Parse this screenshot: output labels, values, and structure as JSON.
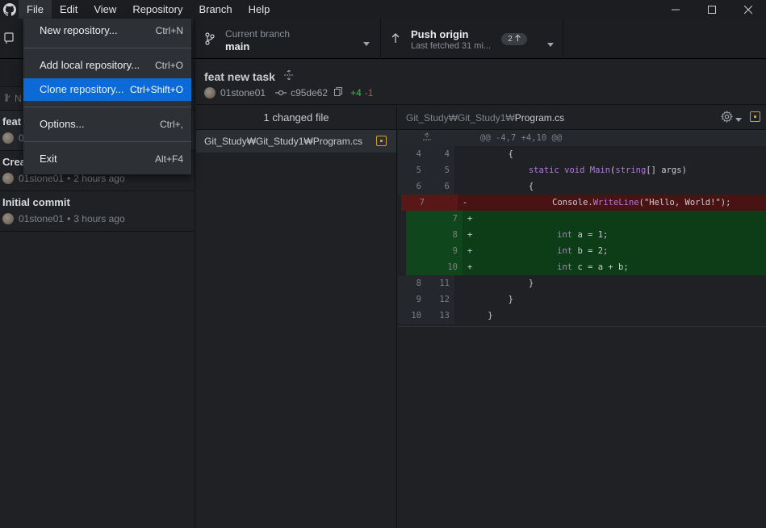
{
  "menu": {
    "items": [
      "File",
      "Edit",
      "View",
      "Repository",
      "Branch",
      "Help"
    ]
  },
  "file_menu": {
    "items": [
      {
        "label": "New repository...",
        "shortcut": "Ctrl+N"
      },
      {
        "label": "Add local repository...",
        "shortcut": "Ctrl+O"
      },
      {
        "label": "Clone repository...",
        "shortcut": "Ctrl+Shift+O"
      },
      {
        "label": "Options...",
        "shortcut": "Ctrl+,"
      },
      {
        "label": "Exit",
        "shortcut": "Alt+F4"
      }
    ]
  },
  "toolbar": {
    "branch_label": "Current branch",
    "branch_name": "main",
    "push_label": "Push origin",
    "push_sub": "Last fetched 31 mi...",
    "push_count": "2"
  },
  "history": {
    "filter_placeholder": "N",
    "commits": [
      {
        "title": "feat",
        "author": "0",
        "time": ""
      },
      {
        "title": "Crea",
        "author": "01stone01",
        "time": "2 hours ago"
      },
      {
        "title": "Initial commit",
        "author": "01stone01",
        "time": "3 hours ago"
      }
    ]
  },
  "commit": {
    "title": "feat new task",
    "author": "01stone01",
    "sha": "c95de62",
    "additions": "+4",
    "deletions": "-1"
  },
  "files": {
    "header": "1 changed file",
    "items": [
      {
        "path": "Git_Study₩Git_Study1₩Program.cs"
      }
    ]
  },
  "diff": {
    "path_prefix": "Git_Study₩Git_Study1₩",
    "path_file": "Program.cs",
    "hunk": "@@ -4,7 +4,10 @@",
    "lines": [
      {
        "o": "4",
        "n": "4",
        "m": "",
        "t": "ctx",
        "code": "        {"
      },
      {
        "o": "5",
        "n": "5",
        "m": "",
        "t": "ctx",
        "code": "            static void Main(string[] args)"
      },
      {
        "o": "6",
        "n": "6",
        "m": "",
        "t": "ctx",
        "code": "            {"
      },
      {
        "o": "7",
        "n": "",
        "m": "-",
        "t": "del",
        "code": "                Console.WriteLine(\"Hello, World!\");"
      },
      {
        "o": "",
        "n": "7",
        "m": "+",
        "t": "add",
        "code": ""
      },
      {
        "o": "",
        "n": "8",
        "m": "+",
        "t": "add",
        "code": "                int a = 1;"
      },
      {
        "o": "",
        "n": "9",
        "m": "+",
        "t": "add",
        "code": "                int b = 2;"
      },
      {
        "o": "",
        "n": "10",
        "m": "+",
        "t": "add",
        "code": "                int c = a + b;"
      },
      {
        "o": "8",
        "n": "11",
        "m": "",
        "t": "ctx",
        "code": "            }"
      },
      {
        "o": "9",
        "n": "12",
        "m": "",
        "t": "ctx",
        "code": "        }"
      },
      {
        "o": "10",
        "n": "13",
        "m": "",
        "t": "ctx",
        "code": "    }"
      }
    ]
  }
}
